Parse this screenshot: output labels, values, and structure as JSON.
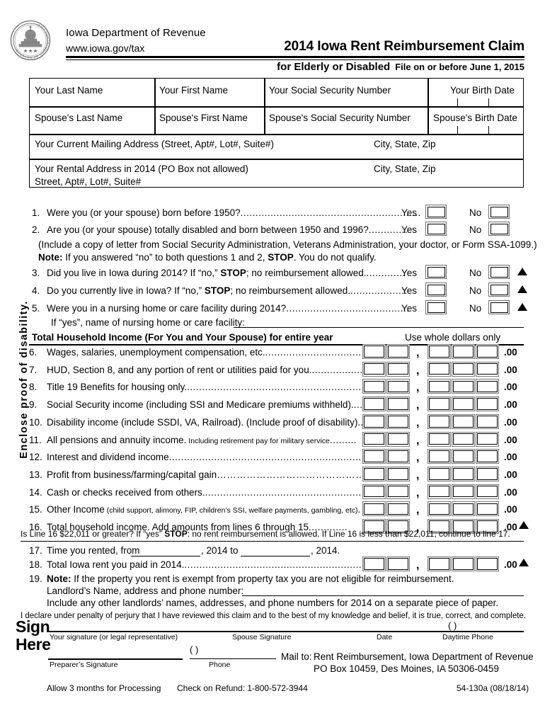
{
  "header": {
    "department": "Iowa Department of Revenue",
    "url": "www.iowa.gov/tax",
    "title": "2014 Iowa Rent Reimbursement Claim",
    "subtitle_main": "for Elderly or Disabled",
    "subtitle_deadline": "File on or before June 1, 2015",
    "seal_text": "IOWA DEPARTMENT OF REVENUE"
  },
  "identity": {
    "your_last_name": "Your Last Name",
    "your_first_name": "Your First Name",
    "your_ssn": "Your Social Security Number",
    "your_birth_date": "Your Birth Date",
    "spouse_last_name": "Spouse's Last Name",
    "spouse_first_name": "Spouse's First Name",
    "spouse_ssn": "Spouse's Social Security Number",
    "spouse_birth_date": "Spouse's Birth Date",
    "mailing_address": "Your Current Mailing Address (Street, Apt#, Lot#, Suite#)",
    "mailing_city_state_zip": "City, State, Zip",
    "rental_address": "Your Rental Address in 2014 (PO Box not allowed)",
    "rental_address_line2": "Street, Apt#, Lot#, Suite#",
    "rental_city_state_zip": "City, State, Zip"
  },
  "side_note": "Enclose proof of disability.",
  "questions": {
    "yes_label": "Yes",
    "no_label": "No",
    "q1_num": "1.",
    "q1_text": "Were you (or your spouse) born before 1950?",
    "q1_dots": "............................................................",
    "q2_num": "2.",
    "q2_text": "Are you (or your spouse) totally disabled and born between 1950 and 1996?",
    "q2_dots": ".............",
    "q2_sub": "(Include a copy of letter from Social Security Administration, Veterans Administration, your doctor, or Form SSA-1099.)",
    "note_label": "Note:",
    "note_text_a": "If you answered “no” to both questions 1 and 2,",
    "note_stop": "STOP",
    "note_text_b": ".  You do not qualify.",
    "q3_num": "3.",
    "q3_a": "Did you live in Iowa during 2014? If “no,”",
    "q3_stop": "STOP",
    "q3_b": "; no reimbursement allowed.",
    "q3_dots": ".............",
    "q4_num": "4.",
    "q4_a": "Do you currently live in Iowa? If “no,”",
    "q4_stop": "STOP",
    "q4_b": "; no reimbursement allowed.",
    "q4_dots": "...................",
    "q5_num": "5.",
    "q5_text": "Were you in a nursing home or care facility during 2014?",
    "q5_dots": ".........................................",
    "q5_sub": "If “yes”, name of nursing home or care facility:"
  },
  "income": {
    "section_title": "Total Household Income (For You and Your Spouse) for entire year",
    "whole_dollars": "Use whole dollars only",
    "comma": ",",
    "cents": ".00",
    "lines": [
      {
        "num": "6.",
        "text": "Wages, salaries, unemployment compensation, etc.",
        "dots": "......................................",
        "small": ""
      },
      {
        "num": "7.",
        "text": "HUD, Section 8, and any portion of rent or utilities paid for you.",
        "dots": "...................",
        "small": ""
      },
      {
        "num": "8.",
        "text": "Title 19 Benefits for housing only.",
        "dots": "..................................................................",
        "small": ""
      },
      {
        "num": "9.",
        "text": "Social Security income (including SSI and Medicare premiums withheld).",
        "dots": "....",
        "small": ""
      },
      {
        "num": "10.",
        "text": "Disability income (include SSDI, VA, Railroad). (Include proof of disability).",
        "dots": ".",
        "small": ""
      },
      {
        "num": "11.",
        "text": "All pensions and annuity income.",
        "dots": ".........",
        "small": "Including retirement pay for military service"
      },
      {
        "num": "12.",
        "text": "Interest and dividend income",
        "dots": "...........................................................................",
        "small": ""
      },
      {
        "num": "13.",
        "text": "Profit from business/farming/capital gain",
        "dots": "………………………………………",
        "small": ""
      },
      {
        "num": "14.",
        "text": "Cash or checks received from others.",
        "dots": "..............................................................",
        "small": ""
      },
      {
        "num": "15.",
        "text": "Other Income",
        "dots": ".",
        "small": "(child support, alimony, FIP, children’s SSI, welfare payments, gambling, etc)"
      },
      {
        "num": "16.",
        "text": "Total household income. Add amounts from lines 6 through 15",
        "dots": ".............",
        "small": ""
      }
    ],
    "threshold_note_a": "Is Line 16 $22,011 or greater? If “yes”",
    "threshold_stop": "STOP",
    "threshold_note_b": ": no rent reimbursement is allowed. If Line 16 is less than $22,011, continue to line 17."
  },
  "rent": {
    "line17_num": "17.",
    "line17_a": "Time you rented, from",
    "line17_b": ", 2014 to",
    "line17_c": ", 2014.",
    "line18_num": "18.",
    "line18_text": "Total Iowa rent you paid in 2014.",
    "line18_dots": "......................................................................",
    "line19_num": "19.",
    "line19_note_label": "Note:",
    "line19_text": "If the property you rent is exempt from property tax you are not eligible for reimbursement.",
    "landlord_label": "Landlord’s Name, address and phone number:",
    "landlord_extra": "Include any other landlords’ names, addresses, and phone numbers for 2014 on a separate piece of paper."
  },
  "signature": {
    "declaration": "I declare under penalty of perjury that I have reviewed this claim and to the best of my knowledge and belief, it is true, correct, and complete.",
    "sign_word": "Sign",
    "here_word": "Here",
    "your_signature": "Your signature (or legal representative)",
    "spouse_signature": "Spouse Signature",
    "date": "Date",
    "daytime_phone": "Daytime Phone",
    "paren": "(          )",
    "preparer_signature": "Preparer’s Signature",
    "phone": "Phone",
    "mail_to_label": "Mail to:",
    "mail_to_line1": "Rent Reimbursement, Iowa Department of Revenue",
    "mail_to_line2": "PO Box 10459, Des Moines, IA  50306-0459"
  },
  "footer": {
    "processing": "Allow 3 months for Processing",
    "refund": "Check on Refund: 1-800-572-3944",
    "form_id": "54-130a (08/18/14)"
  }
}
